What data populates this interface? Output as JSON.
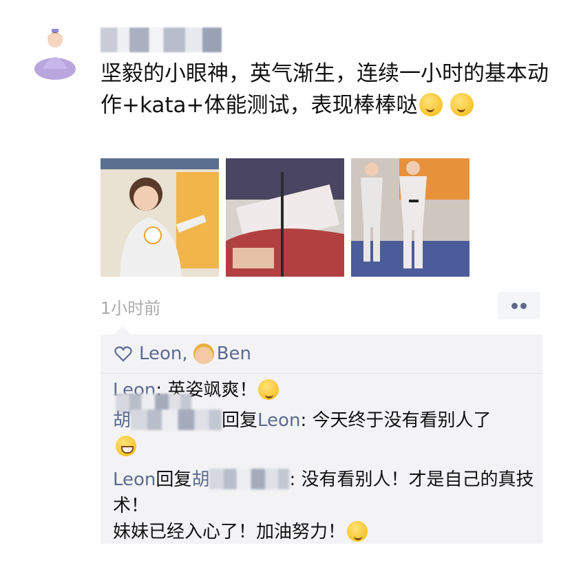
{
  "post": {
    "text": "坚毅的小眼神，英气渐生，连续一小时的基本动作+kata+体能测试，表现棒棒哒",
    "time": "1小时前"
  },
  "likes": {
    "names": [
      "Leon,",
      "Ben"
    ]
  },
  "comments": [
    {
      "author": "Leon",
      "sep": ": ",
      "text": "英姿飒爽！"
    },
    {
      "author": "胡",
      "reply_label": "回复",
      "reply_to": "Leon",
      "sep": ": ",
      "text": "今天终于没有看别人了"
    },
    {
      "author": "Leon",
      "reply_label": "回复",
      "reply_to": "胡",
      "sep": ": ",
      "text": "没有看别人！才是自己的真技术！\n妹妹已经入心了！加油努力！"
    }
  ],
  "colors": {
    "nickname": "#5b6a92",
    "timestamp": "#a9a9a9",
    "comment_bg": "#f3f3f5"
  },
  "icons": [
    "heart-icon",
    "emoji-icon",
    "more-dots-icon"
  ]
}
